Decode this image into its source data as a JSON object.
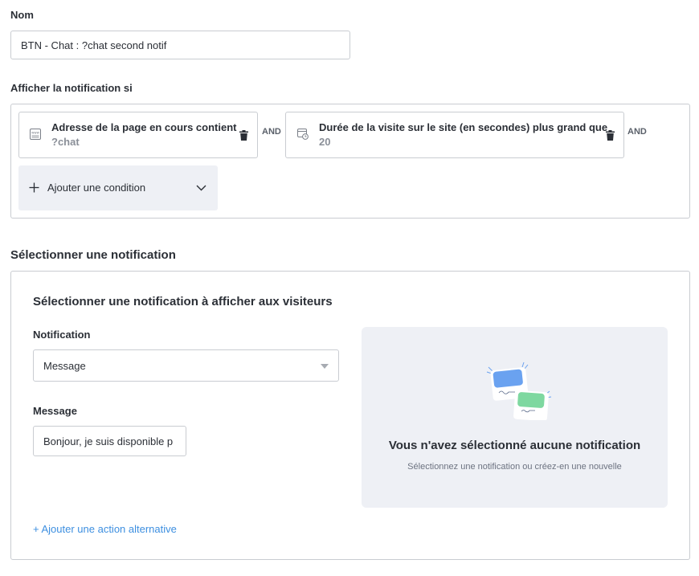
{
  "name_field": {
    "label": "Nom",
    "value": "BTN - Chat : ?chat second notif"
  },
  "conditions": {
    "label": "Afficher la notification si",
    "items": [
      {
        "icon": "www-page-icon",
        "title": "Adresse de la page en cours contient",
        "value": "?chat",
        "connector": "AND"
      },
      {
        "icon": "browser-clock-icon",
        "title": "Durée de la visite sur le site (en secondes) plus grand que",
        "value": "20",
        "connector": "AND"
      }
    ],
    "add_label": "Ajouter une condition"
  },
  "notification_section": {
    "title": "Sélectionner une notification",
    "card_title": "Sélectionner une notification à afficher aux visiteurs",
    "notification_label": "Notification",
    "notification_value": "Message",
    "message_label": "Message",
    "message_value": "Bonjour, je suis disponible p",
    "empty_title": "Vous n'avez sélectionné aucune notification",
    "empty_subtitle": "Sélectionnez une notification ou créez-en une nouvelle",
    "alt_action_label": "+ Ajouter une action alternative"
  },
  "colors": {
    "accent_link": "#3d8fe0",
    "chat_bubble_blue": "#6aa2f0",
    "chat_bubble_green": "#7ed8a0",
    "panel_bg": "#eef0f5"
  }
}
